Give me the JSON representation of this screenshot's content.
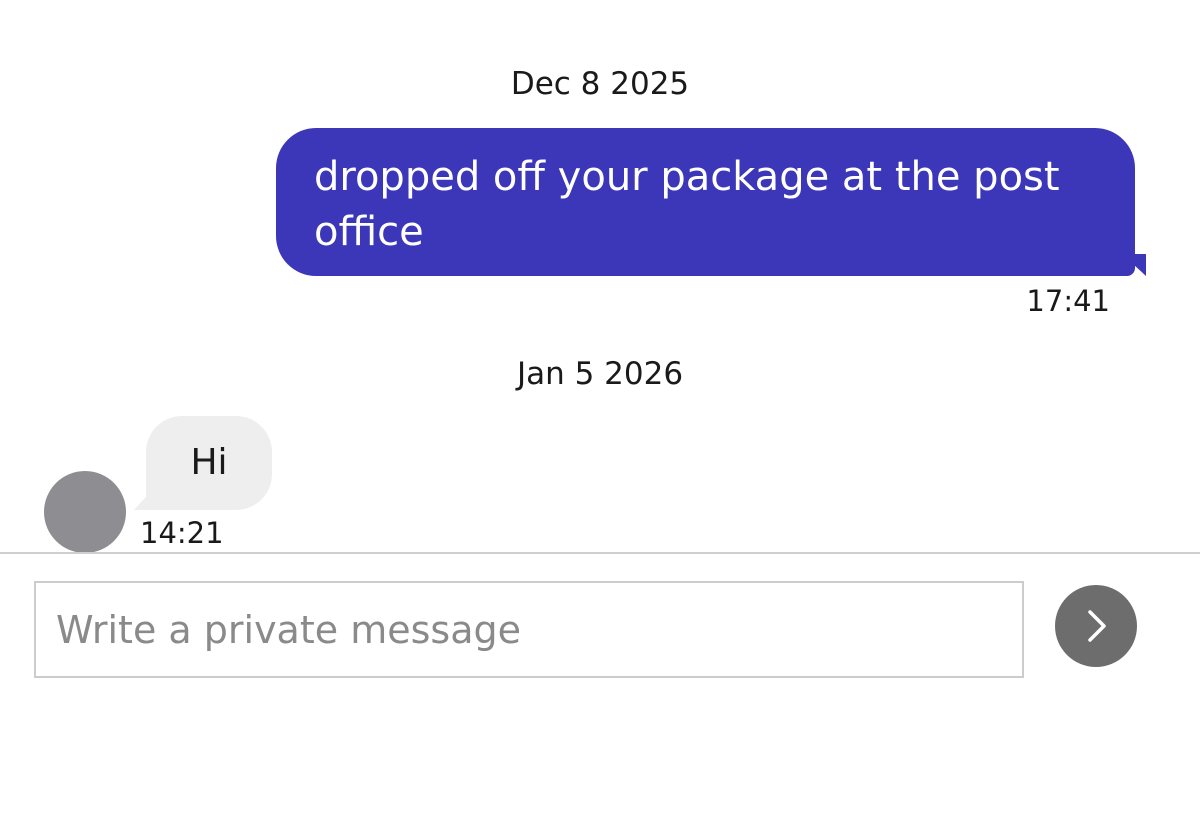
{
  "conversation": {
    "groups": [
      {
        "date": "Dec 8 2025",
        "messages": [
          {
            "direction": "outgoing",
            "text": "dropped off your package at the post office",
            "time": "17:41"
          }
        ]
      },
      {
        "date": "Jan 5 2026",
        "messages": [
          {
            "direction": "incoming",
            "text": "Hi",
            "time": "14:21"
          }
        ]
      }
    ]
  },
  "composer": {
    "placeholder": "Write a private message",
    "value": "",
    "send_icon": "chevron-right-icon"
  },
  "colors": {
    "outgoing_bubble": "#3c36b8",
    "incoming_bubble": "#eeeeee",
    "avatar": "#8e8d92",
    "send_button": "#6d6d6d"
  }
}
